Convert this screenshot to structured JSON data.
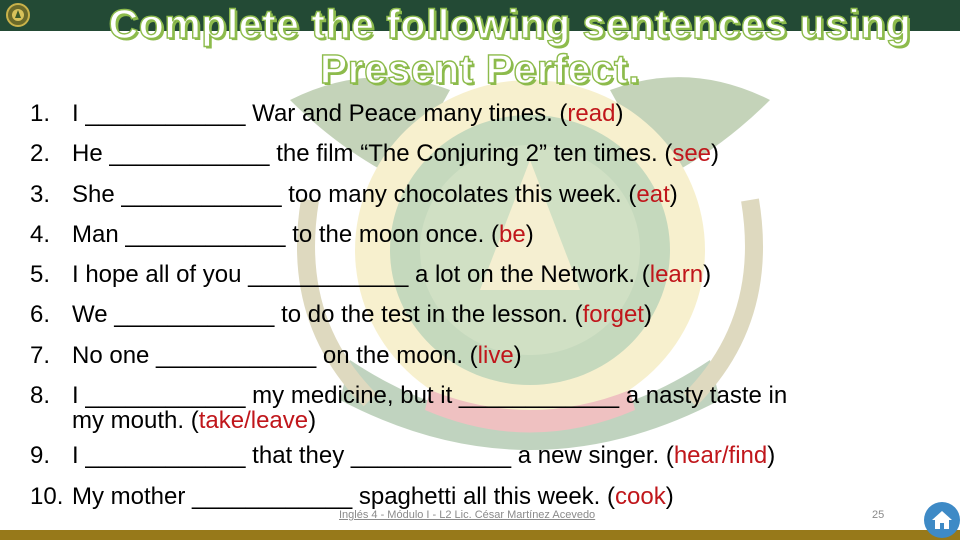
{
  "header": {
    "title_line1": "Complete the following sentences using",
    "title_line2": "Present Perfect.",
    "logo": "university-crest-icon"
  },
  "exercises": [
    {
      "number": "1.",
      "parts": [
        {
          "t": "I ____________ War and Peace many times. ("
        },
        {
          "t": "read",
          "verb": true
        },
        {
          "t": ")"
        }
      ]
    },
    {
      "number": "2.",
      "parts": [
        {
          "t": "He ____________ the film “The Conjuring 2” ten times. ("
        },
        {
          "t": "see",
          "verb": true
        },
        {
          "t": ")"
        }
      ]
    },
    {
      "number": "3.",
      "parts": [
        {
          "t": "She ____________ too many chocolates this week. ("
        },
        {
          "t": "eat",
          "verb": true
        },
        {
          "t": ")"
        }
      ]
    },
    {
      "number": "4.",
      "parts": [
        {
          "t": "Man ____________ to the moon once. ("
        },
        {
          "t": "be",
          "verb": true
        },
        {
          "t": ")"
        }
      ]
    },
    {
      "number": "5.",
      "parts": [
        {
          "t": "I hope all of you ____________ a lot on the Network. ("
        },
        {
          "t": "learn",
          "verb": true
        },
        {
          "t": ")"
        }
      ]
    },
    {
      "number": "6.",
      "parts": [
        {
          "t": "We ____________ to do the test in the lesson. ("
        },
        {
          "t": "forget",
          "verb": true
        },
        {
          "t": ")"
        }
      ]
    },
    {
      "number": "7.",
      "parts": [
        {
          "t": "No one ____________ on the moon. ("
        },
        {
          "t": "live",
          "verb": true
        },
        {
          "t": ")"
        }
      ]
    },
    {
      "number": "8.",
      "parts": [
        {
          "t": "I ____________ my medicine, but it ____________ a nasty taste in"
        }
      ],
      "continuation": [
        {
          "t": "my mouth. ("
        },
        {
          "t": "take/leave",
          "verb": true
        },
        {
          "t": ")"
        }
      ]
    },
    {
      "number": "9.",
      "parts": [
        {
          "t": "I ____________ that they ____________ a new singer. ("
        },
        {
          "t": "hear/find",
          "verb": true
        },
        {
          "t": ")"
        }
      ]
    },
    {
      "number": "10.",
      "parts": [
        {
          "t": "My mother ____________ spaghetti all this week. ("
        },
        {
          "t": "cook",
          "verb": true
        },
        {
          "t": ")"
        }
      ]
    }
  ],
  "footer": {
    "text": "Inglés 4 - Módulo I - L2 Lic. César Martínez Acevedo",
    "page_number": "25",
    "home_button": "home-icon"
  },
  "colors": {
    "header_band": "#234a35",
    "title_outline": "#8dbb4c",
    "verb_hint": "#c0161b",
    "footer_band": "#97791a",
    "home_button": "#3e8ac6"
  }
}
